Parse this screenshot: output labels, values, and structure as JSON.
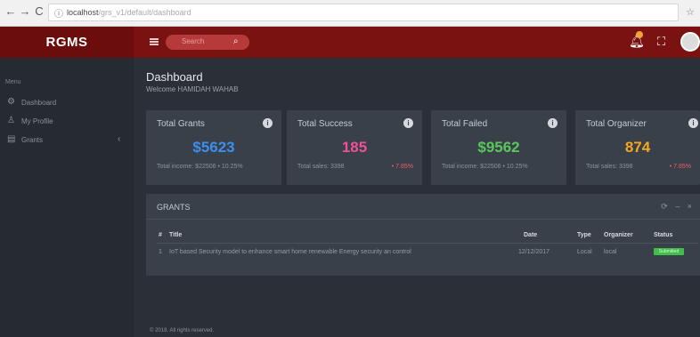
{
  "browser": {
    "back": "←",
    "forward": "→",
    "reload": "C",
    "info": "ⓘ",
    "url_host": "localhost",
    "url_path": "/grs_v1/default/dashboard",
    "star": "☆"
  },
  "header": {
    "brand": "RGMS",
    "search_placeholder": "Search",
    "search_icon": "search-icon",
    "bell_icon": "bell-icon",
    "expand_icon": "expand-icon"
  },
  "sidebar": {
    "menu_title": "Menu",
    "items": [
      {
        "icon": "dashboard-icon",
        "glyph": "⚙",
        "label": "Dashboard"
      },
      {
        "icon": "user-icon",
        "glyph": "♙",
        "label": "My Profile"
      },
      {
        "icon": "grants-icon",
        "glyph": "▤",
        "label": "Grants",
        "chevron": "‹"
      }
    ]
  },
  "page": {
    "title": "Dashboard",
    "welcome": "Welcome HAMIDAH WAHAB"
  },
  "cards": [
    {
      "title": "Total Grants",
      "value": "$5623",
      "color": "#3d8ef0",
      "footer": "Total income: $22506 • 10.25%",
      "trend": ""
    },
    {
      "title": "Total Success",
      "value": "185",
      "color": "#f04f9a",
      "footer": "Total sales: 3398",
      "trend": "• 7.85%"
    },
    {
      "title": "Total Failed",
      "value": "$9562",
      "color": "#58c85a",
      "footer": "Total income: $22506 • 10.25%",
      "trend": ""
    },
    {
      "title": "Total Organizer",
      "value": "874",
      "color": "#f5a623",
      "footer": "Total sales: 3398",
      "trend": "• 7.85%"
    }
  ],
  "grants": {
    "title": "GRANTS",
    "tools": "⟳ – ×",
    "columns": [
      "#",
      "Title",
      "Date",
      "Type",
      "Organizer",
      "Status"
    ],
    "rows": [
      {
        "num": "1",
        "title": "IoT based Security model to enhance smart home renewable Energy security an control",
        "date": "12/12/2017",
        "type": "Local",
        "organizer": "local",
        "status": "Submitted"
      }
    ]
  },
  "footer": "© 2018. All rights reserved."
}
